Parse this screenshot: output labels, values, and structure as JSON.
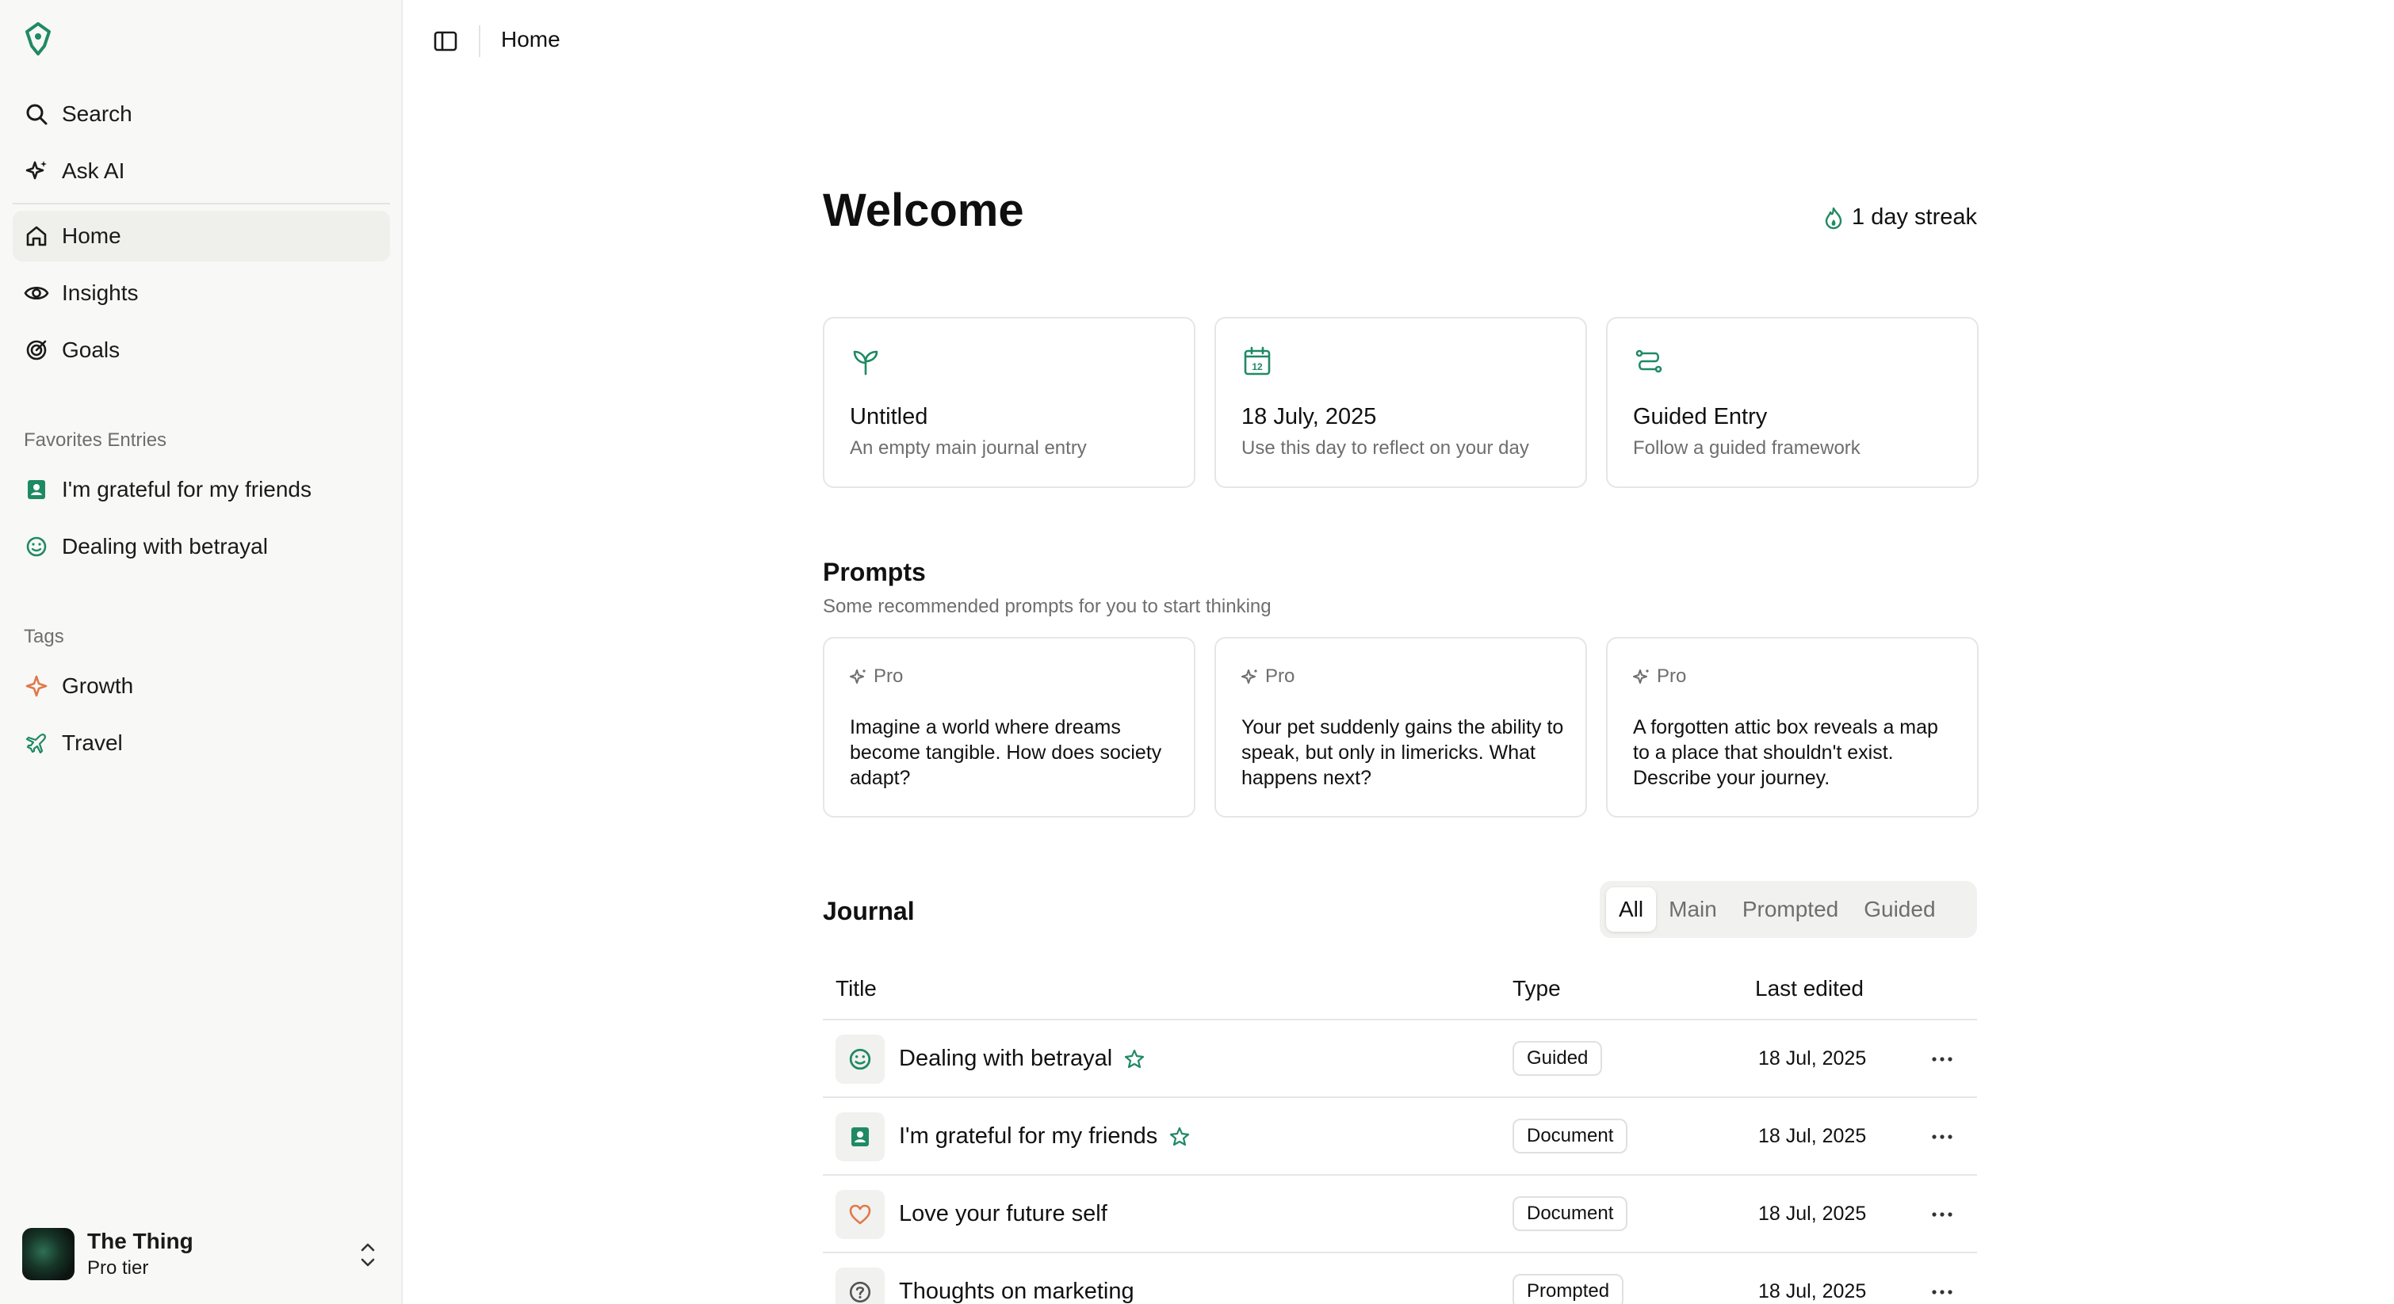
{
  "sidebar": {
    "nav_top": [
      {
        "label": "Search",
        "icon": "search-icon"
      },
      {
        "label": "Ask AI",
        "icon": "sparkles-icon"
      }
    ],
    "nav_main": [
      {
        "label": "Home",
        "icon": "home-icon",
        "active": true
      },
      {
        "label": "Insights",
        "icon": "eye-icon"
      },
      {
        "label": "Goals",
        "icon": "target-icon"
      }
    ],
    "favorites_label": "Favorites Entries",
    "favorites": [
      {
        "label": "I'm grateful for my friends",
        "icon": "contact-book-icon"
      },
      {
        "label": "Dealing with betrayal",
        "icon": "smiley-icon"
      }
    ],
    "tags_label": "Tags",
    "tags": [
      {
        "label": "Growth",
        "icon": "sparkle-icon",
        "color": "#e0784a"
      },
      {
        "label": "Travel",
        "icon": "plane-icon",
        "color": "#1f8a63"
      }
    ],
    "user": {
      "name": "The Thing",
      "tier": "Pro tier"
    }
  },
  "topbar": {
    "title": "Home"
  },
  "main": {
    "welcome": "Welcome",
    "streak": "1 day streak",
    "quick_cards": [
      {
        "title": "Untitled",
        "subtitle": "An empty main journal entry",
        "icon": "sprout-icon"
      },
      {
        "title": "18 July, 2025",
        "subtitle": "Use this day to reflect on your day",
        "icon": "calendar-icon",
        "icon_text": "12"
      },
      {
        "title": "Guided Entry",
        "subtitle": "Follow a guided framework",
        "icon": "route-icon"
      }
    ],
    "prompts": {
      "title": "Prompts",
      "subtitle": "Some recommended prompts for you to start thinking",
      "items": [
        {
          "badge": "Pro",
          "text": "Imagine a world where dreams become tangible. How does society adapt?"
        },
        {
          "badge": "Pro",
          "text": "Your pet suddenly gains the ability to speak, but only in limericks. What happens next?"
        },
        {
          "badge": "Pro",
          "text": "A forgotten attic box reveals a map to a place that shouldn't exist. Describe your journey."
        }
      ]
    },
    "journal": {
      "title": "Journal",
      "filters": [
        "All",
        "Main",
        "Prompted",
        "Guided"
      ],
      "columns": {
        "title": "Title",
        "type": "Type",
        "last_edited": "Last edited"
      },
      "rows": [
        {
          "title": "Dealing with betrayal",
          "type": "Guided",
          "date": "18 Jul, 2025",
          "icon": "smiley-icon",
          "starred": true
        },
        {
          "title": "I'm grateful for my friends",
          "type": "Document",
          "date": "18 Jul, 2025",
          "icon": "contact-book-icon",
          "starred": true
        },
        {
          "title": "Love your future self",
          "type": "Document",
          "date": "18 Jul, 2025",
          "icon": "heart-icon",
          "starred": false
        },
        {
          "title": "Thoughts on marketing",
          "type": "Prompted",
          "date": "18 Jul, 2025",
          "icon": "question-icon",
          "starred": false
        }
      ]
    }
  },
  "colors": {
    "accent": "#1f8a63",
    "tag_growth": "#e0784a",
    "heart": "#e0784a"
  }
}
